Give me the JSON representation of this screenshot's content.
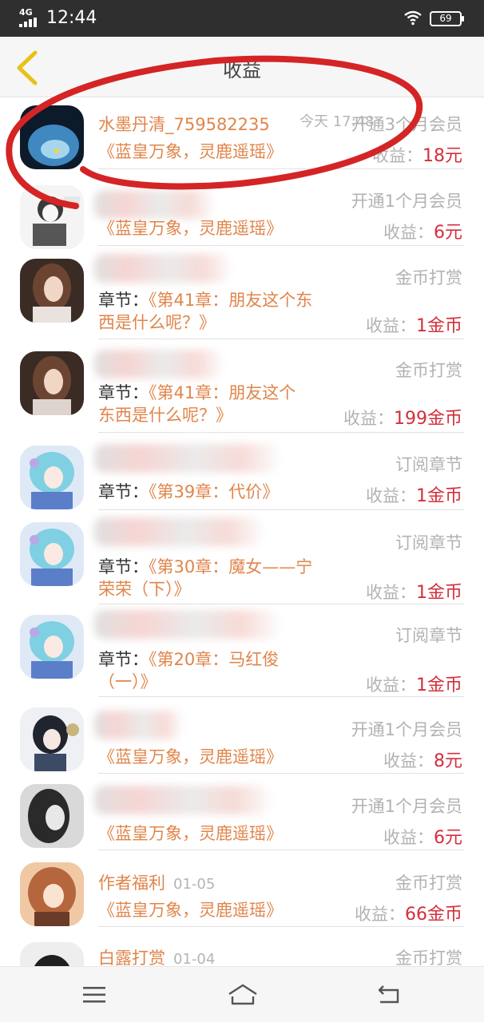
{
  "status": {
    "network": "4G",
    "time": "12:44",
    "battery": "69"
  },
  "header": {
    "title": "收益"
  },
  "colors": {
    "accent": "#e0854a",
    "amount": "#d32f3c",
    "muted": "#b2b2b2",
    "annotation": "#d42425"
  },
  "rows": [
    {
      "name": "水墨丹清_759582235",
      "date": "今天 17:48",
      "type": "开通3个月会员",
      "lead": "",
      "line1": "《蓝皇万象，灵鹿遥瑶》",
      "line2": "",
      "earn_label": "收益：",
      "earn_value": "18元"
    },
    {
      "name": "",
      "date": "",
      "type": "开通1个月会员",
      "lead": "",
      "line1": "《蓝皇万象，灵鹿遥瑶》",
      "line2": "",
      "earn_label": "收益：",
      "earn_value": "6元"
    },
    {
      "name": "",
      "date": "",
      "type": "金币打赏",
      "lead": "章节：",
      "line1": "《第41章：朋友这个东",
      "line2": "西是什么呢？》",
      "earn_label": "收益：",
      "earn_value": "1金币"
    },
    {
      "name": "",
      "date": "",
      "type": "金币打赏",
      "lead": "章节：",
      "line1": "《第41章：朋友这个",
      "line2": "东西是什么呢？》",
      "earn_label": "收益：",
      "earn_value": "199金币"
    },
    {
      "name": "",
      "date": "",
      "type": "订阅章节",
      "lead": "章节：",
      "line1": "《第39章：代价》",
      "line2": "",
      "earn_label": "收益：",
      "earn_value": "1金币"
    },
    {
      "name": "",
      "date": "",
      "type": "订阅章节",
      "lead": "章节：",
      "line1": "《第30章：魔女——宁",
      "line2": "荣荣（下）》",
      "earn_label": "收益：",
      "earn_value": "1金币"
    },
    {
      "name": "",
      "date": "",
      "type": "订阅章节",
      "lead": "章节：",
      "line1": "《第20章：马红俊",
      "line2": "（一）》",
      "earn_label": "收益：",
      "earn_value": "1金币"
    },
    {
      "name": "",
      "date": "",
      "type": "开通1个月会员",
      "lead": "",
      "line1": "《蓝皇万象，灵鹿遥瑶》",
      "line2": "",
      "earn_label": "收益：",
      "earn_value": "8元"
    },
    {
      "name": "",
      "date": "",
      "type": "开通1个月会员",
      "lead": "",
      "line1": "《蓝皇万象，灵鹿遥瑶》",
      "line2": "",
      "earn_label": "收益：",
      "earn_value": "6元"
    },
    {
      "name": "作者福利",
      "date": "01-05",
      "type": "金币打赏",
      "lead": "",
      "line1": "《蓝皇万象，灵鹿遥瑶》",
      "line2": "",
      "earn_label": "收益：",
      "earn_value": "66金币"
    },
    {
      "name": "白露打赏",
      "date": "01-04",
      "type": "金币打赏",
      "lead": "",
      "line1": "",
      "line2": "",
      "earn_label": "",
      "earn_value": ""
    }
  ]
}
